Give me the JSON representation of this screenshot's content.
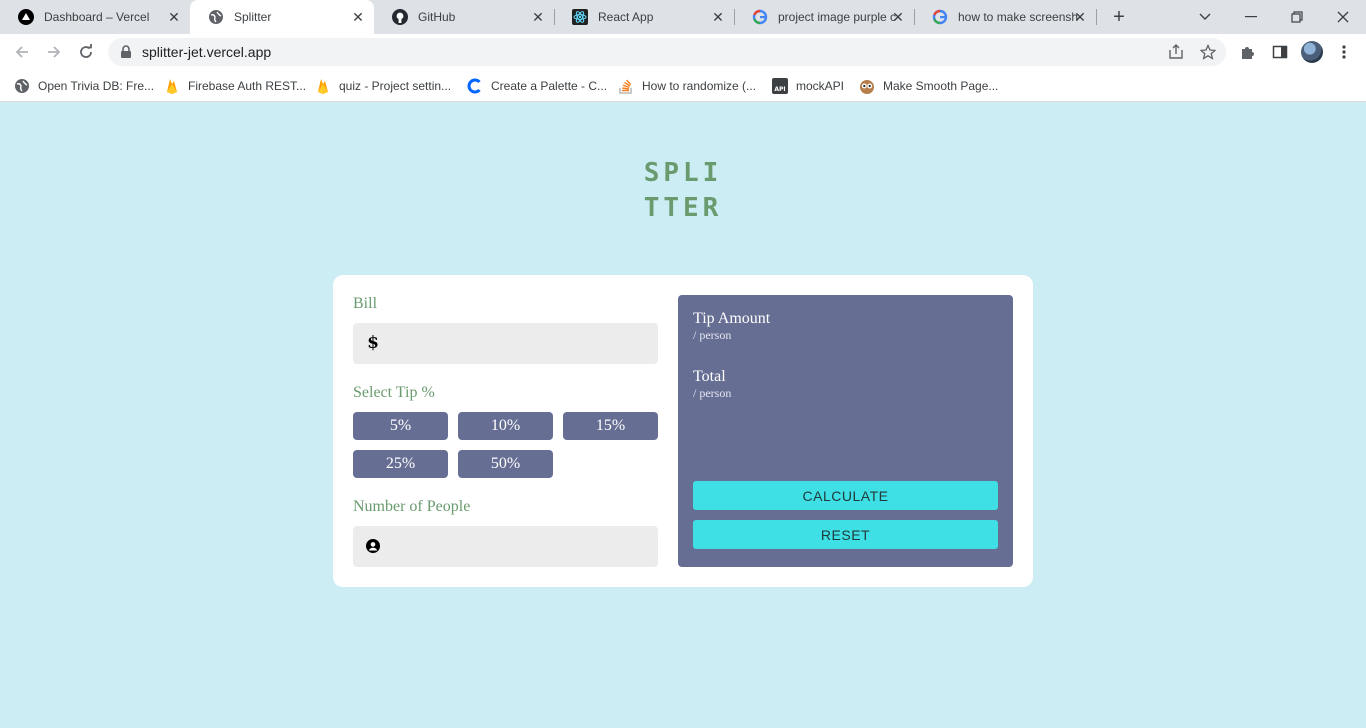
{
  "browser": {
    "tabs": [
      {
        "title": "Dashboard – Vercel",
        "icon": "vercel-icon"
      },
      {
        "title": "Splitter",
        "icon": "globe-icon"
      },
      {
        "title": "GitHub",
        "icon": "github-icon"
      },
      {
        "title": "React App",
        "icon": "react-icon"
      },
      {
        "title": "project image purple c",
        "icon": "google-icon"
      },
      {
        "title": "how to make screensh",
        "icon": "google-icon"
      }
    ],
    "url": "splitter-jet.vercel.app",
    "bookmarks": [
      {
        "label": "Open Trivia DB: Fre...",
        "icon": "globe-icon"
      },
      {
        "label": "Firebase Auth REST...",
        "icon": "firebase-icon"
      },
      {
        "label": "quiz - Project settin...",
        "icon": "firebase-icon"
      },
      {
        "label": "Create a Palette - C...",
        "icon": "coolors-icon"
      },
      {
        "label": "How to randomize (...",
        "icon": "stackoverflow-icon"
      },
      {
        "label": "mockAPI",
        "icon": "mockapi-icon"
      },
      {
        "label": "Make Smooth Page...",
        "icon": "owl-icon"
      }
    ]
  },
  "app": {
    "logo_line1": "SPLI",
    "logo_line2": "TTER",
    "bill_label": "Bill",
    "bill_icon": "$",
    "bill_value": "",
    "tip_label": "Select Tip %",
    "tip_options": [
      "5%",
      "10%",
      "15%",
      "25%",
      "50%"
    ],
    "people_label": "Number of People",
    "people_value": "",
    "tip_amount_label": "Tip Amount",
    "tip_amount_sub": "/ person",
    "total_label": "Total",
    "total_sub": "/ person",
    "calculate_label": "CALCULATE",
    "reset_label": "RESET"
  },
  "colors": {
    "page_bg": "#cbedf3",
    "accent_green": "#6a9b6e",
    "panel": "#676e94",
    "button_cyan": "#3fe0e5"
  }
}
